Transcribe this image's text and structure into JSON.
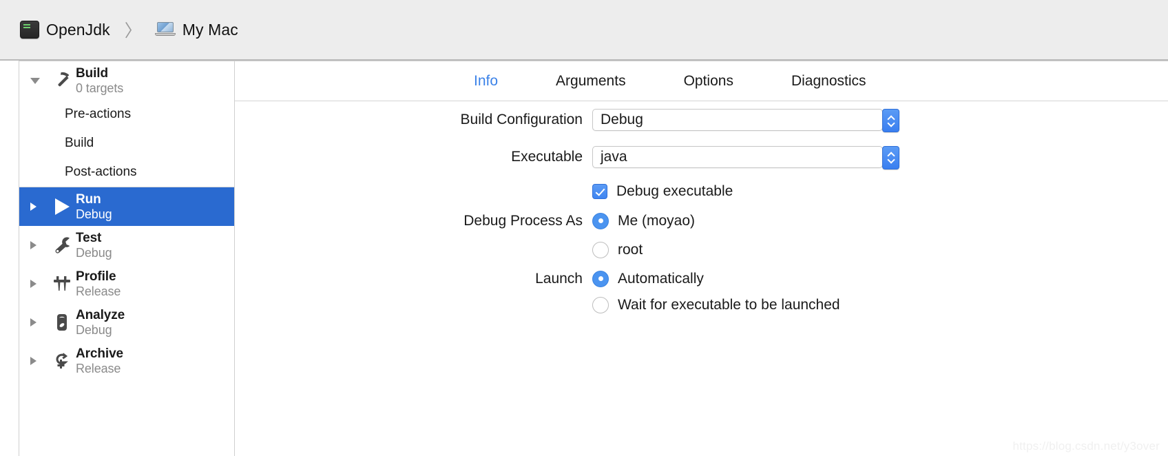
{
  "breadcrumb": {
    "scheme": {
      "label": "OpenJdk",
      "icon": "terminal-icon"
    },
    "separator": "〉",
    "destination": {
      "label": "My Mac",
      "icon": "laptop-icon"
    }
  },
  "sidebar": {
    "groups": [
      {
        "id": "build",
        "title": "Build",
        "subtitle": "0 targets",
        "icon": "hammer-icon",
        "expanded": true,
        "disclosure": "triangle-down-icon",
        "selected": false,
        "children": [
          {
            "label": "Pre-actions"
          },
          {
            "label": "Build"
          },
          {
            "label": "Post-actions"
          }
        ]
      },
      {
        "id": "run",
        "title": "Run",
        "subtitle": "Debug",
        "icon": "play-icon",
        "expanded": false,
        "disclosure": "triangle-right-icon",
        "selected": true,
        "children": []
      },
      {
        "id": "test",
        "title": "Test",
        "subtitle": "Debug",
        "icon": "wrench-icon",
        "expanded": false,
        "disclosure": "triangle-right-icon",
        "selected": false,
        "children": []
      },
      {
        "id": "profile",
        "title": "Profile",
        "subtitle": "Release",
        "icon": "caliper-icon",
        "expanded": false,
        "disclosure": "triangle-right-icon",
        "selected": false,
        "children": []
      },
      {
        "id": "analyze",
        "title": "Analyze",
        "subtitle": "Debug",
        "icon": "stethoscope-icon",
        "expanded": false,
        "disclosure": "triangle-right-icon",
        "selected": false,
        "children": []
      },
      {
        "id": "archive",
        "title": "Archive",
        "subtitle": "Release",
        "icon": "archive-icon",
        "expanded": false,
        "disclosure": "triangle-right-icon",
        "selected": false,
        "children": []
      }
    ]
  },
  "main": {
    "tabs": [
      {
        "label": "Info",
        "active": true
      },
      {
        "label": "Arguments",
        "active": false
      },
      {
        "label": "Options",
        "active": false
      },
      {
        "label": "Diagnostics",
        "active": false
      }
    ],
    "fields": {
      "build_configuration": {
        "label": "Build Configuration",
        "value": "Debug",
        "control": "popup-button",
        "stepper_icon": "chevron-up-down-icon"
      },
      "executable": {
        "label": "Executable",
        "value": "java",
        "control": "popup-button",
        "stepper_icon": "chevron-up-down-icon"
      },
      "debug_executable": {
        "label": "Debug executable",
        "checked": true,
        "control": "checkbox"
      },
      "debug_process_as": {
        "label": "Debug Process As",
        "control": "radio-group",
        "selected": "me",
        "options": [
          {
            "id": "me",
            "label": "Me (moyao)",
            "selected": true
          },
          {
            "id": "root",
            "label": "root",
            "selected": false
          }
        ]
      },
      "launch": {
        "label": "Launch",
        "control": "radio-group",
        "selected": "automatically",
        "options": [
          {
            "id": "automatically",
            "label": "Automatically",
            "selected": true
          },
          {
            "id": "wait",
            "label": "Wait for executable to be launched",
            "selected": false
          }
        ]
      }
    }
  },
  "watermark": "https://blog.csdn.net/y3over",
  "colors": {
    "accent_blue": "#2a6ad0",
    "control_blue": "#4b94f0",
    "tab_active": "#3b82e8",
    "header_bg": "#ededed",
    "subtitle_gray": "#8a8a8a"
  }
}
